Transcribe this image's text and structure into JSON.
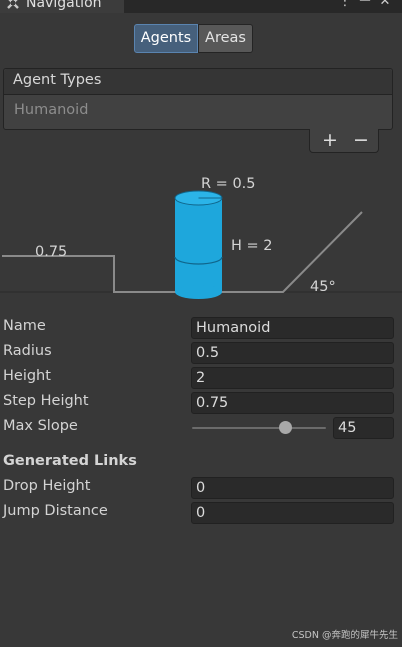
{
  "window": {
    "tab_title": "Navigation",
    "tab_icon": "navigation-icon",
    "controls": [
      "menu-icon",
      "maximize-icon",
      "close-icon"
    ]
  },
  "tabs": {
    "agents_label": "Agents",
    "areas_label": "Areas",
    "active": "Agents"
  },
  "agent_types": {
    "header": "Agent Types",
    "items": [
      "Humanoid"
    ],
    "add_label": "+",
    "remove_label": "−"
  },
  "diagram": {
    "radius_label": "R = 0.5",
    "height_label": "H = 2",
    "step_label": "0.75",
    "slope_label": "45°"
  },
  "properties": {
    "name_label": "Name",
    "name_value": "Humanoid",
    "radius_label": "Radius",
    "radius_value": "0.5",
    "height_label": "Height",
    "height_value": "2",
    "step_height_label": "Step Height",
    "step_height_value": "0.75",
    "max_slope_label": "Max Slope",
    "max_slope_value": "45",
    "max_slope_fraction": 0.7
  },
  "generated_links": {
    "header": "Generated Links",
    "drop_height_label": "Drop Height",
    "drop_height_value": "0",
    "jump_distance_label": "Jump Distance",
    "jump_distance_value": "0"
  },
  "colors": {
    "background": "#383838",
    "accent_tab": "#46607c",
    "agent_cylinder": "#1ea7dc"
  },
  "watermark": "CSDN @奔跑的犀牛先生"
}
